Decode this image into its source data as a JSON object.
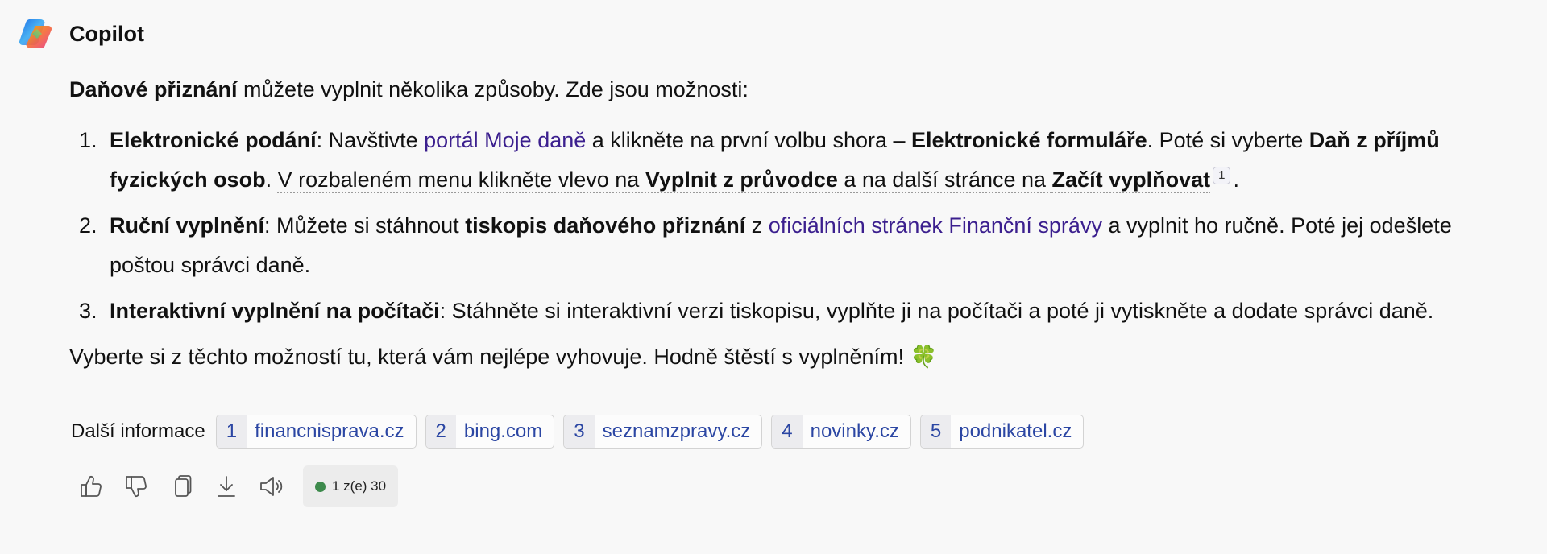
{
  "app": {
    "title": "Copilot"
  },
  "message": {
    "intro_bold": "Daňové přiznání",
    "intro_rest": " můžete vyplnit několika způsoby. Zde jsou možnosti:",
    "items": [
      {
        "title": "Elektronické podání",
        "parts": {
          "a": ": Navštivte ",
          "link": "portál Moje daně",
          "b": " a klikněte na první volbu shora – ",
          "bold1": "Elektronické formuláře",
          "c": ". Poté si vyberte ",
          "bold2": "Daň z příjmů fyzických osob",
          "d": ". ",
          "e": "V rozbaleném menu klikněte vlevo na ",
          "bold3": "Vyplnit z průvodce",
          "f": " a na další stránce na ",
          "bold4": "Začít vyplňovat",
          "cite": "1",
          "g": "."
        }
      },
      {
        "title": "Ruční vyplnění",
        "parts": {
          "a": ": Můžete si stáhnout ",
          "bold1": "tiskopis daňového přiznání",
          "b": " z ",
          "link": "oficiálních stránek Finanční správy",
          "c": " a vyplnit ho ručně. Poté jej odešlete poštou správci daně."
        }
      },
      {
        "title": "Interaktivní vyplnění na počítači",
        "parts": {
          "a": ": Stáhněte si interaktivní verzi tiskopisu, vyplňte ji na počítači a poté ji vytiskněte a dodate správci daně."
        }
      }
    ],
    "closing": "Vyberte si z těchto možností tu, která vám nejlépe vyhovuje. Hodně štěstí s vyplněním! 🍀"
  },
  "sources": {
    "label": "Další informace",
    "items": [
      {
        "num": "1",
        "domain": "financnisprava.cz"
      },
      {
        "num": "2",
        "domain": "bing.com"
      },
      {
        "num": "3",
        "domain": "seznamzpravy.cz"
      },
      {
        "num": "4",
        "domain": "novinky.cz"
      },
      {
        "num": "5",
        "domain": "podnikatel.cz"
      }
    ]
  },
  "actions": {
    "icons": [
      "thumbs-up-icon",
      "thumbs-down-icon",
      "copy-icon",
      "download-icon",
      "speaker-icon"
    ],
    "counter": "1 z(e) 30",
    "counter_color": "#3d8a4c"
  }
}
